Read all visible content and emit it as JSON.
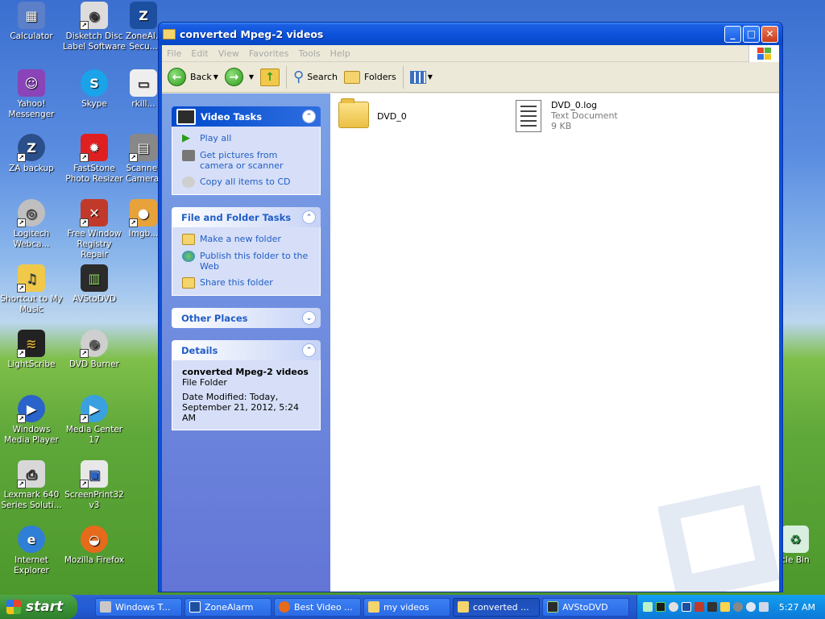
{
  "desktop": {
    "icons": [
      {
        "label": "Calculator",
        "icon": "calculator-icon"
      },
      {
        "label": "Disketch Disc Label Software",
        "icon": "disketch-icon"
      },
      {
        "label": "ZoneAl... Secu...",
        "icon": "zonealarm-security-icon"
      },
      {
        "label": "Yahoo! Messenger",
        "icon": "yahoo-messenger-icon"
      },
      {
        "label": "Skype",
        "icon": "skype-icon"
      },
      {
        "label": "rkill...",
        "icon": "rkill-icon"
      },
      {
        "label": "ZA backup",
        "icon": "za-backup-icon"
      },
      {
        "label": "FastStone Photo Resizer",
        "icon": "faststone-icon"
      },
      {
        "label": "Scanner Camera...",
        "icon": "scanner-camera-icon"
      },
      {
        "label": "Logitech Webca...",
        "icon": "webcam-icon"
      },
      {
        "label": "Free Window Registry Repair",
        "icon": "registry-repair-icon"
      },
      {
        "label": "Imgb...",
        "icon": "imgburn-icon"
      },
      {
        "label": "Shortcut to My Music",
        "icon": "my-music-icon"
      },
      {
        "label": "AVStoDVD",
        "icon": "avstodvd-icon"
      },
      {
        "label": "LightScribe",
        "icon": "lightscribe-icon"
      },
      {
        "label": "DVD Burner",
        "icon": "dvd-burner-icon"
      },
      {
        "label": "Windows Media Player",
        "icon": "media-player-icon"
      },
      {
        "label": "Media Center 17",
        "icon": "media-center-icon"
      },
      {
        "label": "Lexmark 640 Series Soluti...",
        "icon": "printer-icon"
      },
      {
        "label": "ScreenPrint32 v3",
        "icon": "screenprint-icon"
      },
      {
        "label": "Internet Explorer",
        "icon": "ie-icon"
      },
      {
        "label": "Mozilla Firefox",
        "icon": "firefox-icon"
      },
      {
        "label": "cle Bin",
        "icon": "recycle-bin-icon"
      }
    ]
  },
  "window": {
    "title": "converted Mpeg-2 videos",
    "menu": [
      "File",
      "Edit",
      "View",
      "Favorites",
      "Tools",
      "Help"
    ],
    "toolbar": {
      "back": "Back",
      "search": "Search",
      "folders": "Folders"
    },
    "video_tasks": {
      "title": "Video Tasks",
      "items": [
        "Play all",
        "Get pictures from camera or scanner",
        "Copy all items to CD"
      ]
    },
    "file_folder_tasks": {
      "title": "File and Folder Tasks",
      "items": [
        "Make a new folder",
        "Publish this folder to the Web",
        "Share this folder"
      ]
    },
    "other_places": {
      "title": "Other Places"
    },
    "details": {
      "title": "Details",
      "name": "converted Mpeg-2 videos",
      "type": "File Folder",
      "modified": "Date Modified: Today, September 21, 2012, 5:24 AM"
    },
    "files": [
      {
        "name": "DVD_0"
      },
      {
        "name": "DVD_0.log",
        "type": "Text Document",
        "size": "9 KB"
      }
    ]
  },
  "taskbar": {
    "start": "start",
    "buttons": [
      "Windows T...",
      "ZoneAlarm",
      "Best Video ...",
      "my videos",
      "converted ...",
      "AVStoDVD"
    ],
    "clock": "5:27 AM"
  },
  "colors": {
    "accent": "#0a50d8",
    "link": "#215dc6"
  }
}
